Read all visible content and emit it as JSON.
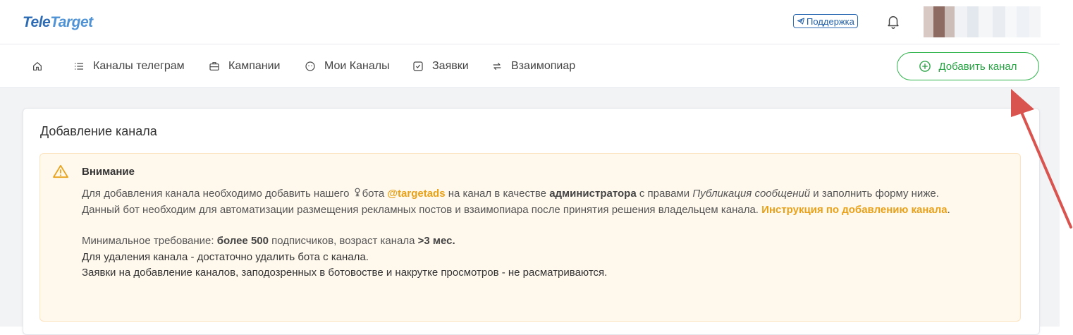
{
  "header": {
    "logo_part1": "Tele",
    "logo_part2": "Target",
    "support_label": "Поддержка"
  },
  "nav": {
    "items": [
      {
        "label": "Каналы телеграм"
      },
      {
        "label": "Кампании"
      },
      {
        "label": "Мои Каналы"
      },
      {
        "label": "Заявки"
      },
      {
        "label": "Взаимопиар"
      }
    ],
    "add_channel_label": "Добавить канал"
  },
  "card": {
    "title": "Добавление канала",
    "alert": {
      "title": "Внимание",
      "l1_a": "Для добавления канала необходимо добавить нашего ",
      "l1_bot": "бота ",
      "l1_handle": "@targetads",
      "l1_b": " на канал в качестве ",
      "l1_admin": "администратора",
      "l1_c": " с правами ",
      "l1_rights": "Публикация сообщений",
      "l1_d": " и заполнить форму ниже.",
      "l2_a": "Данный бот необходим для автоматизации размещения рекламных постов и взаимопиара после принятия решения владельцем канала. ",
      "l2_link": "Инструкция по добавлению канала",
      "l2_end": ".",
      "l3_a": "Минимальное требование: ",
      "l3_subs": "более 500",
      "l3_b": " подписчиков, возраст канала ",
      "l3_age": ">3 мес.",
      "l4": "Для удаления канала - достаточно удалить бота с канала.",
      "l5": "Заявки на добавление каналов, заподозренных в ботовостве и накрутке просмотров - не расматриваются."
    }
  },
  "colors": {
    "brand_blue": "#2d6cb5",
    "success_green": "#2eb24a",
    "warning_orange": "#e8a21a",
    "arrow_red": "#d9534f"
  }
}
